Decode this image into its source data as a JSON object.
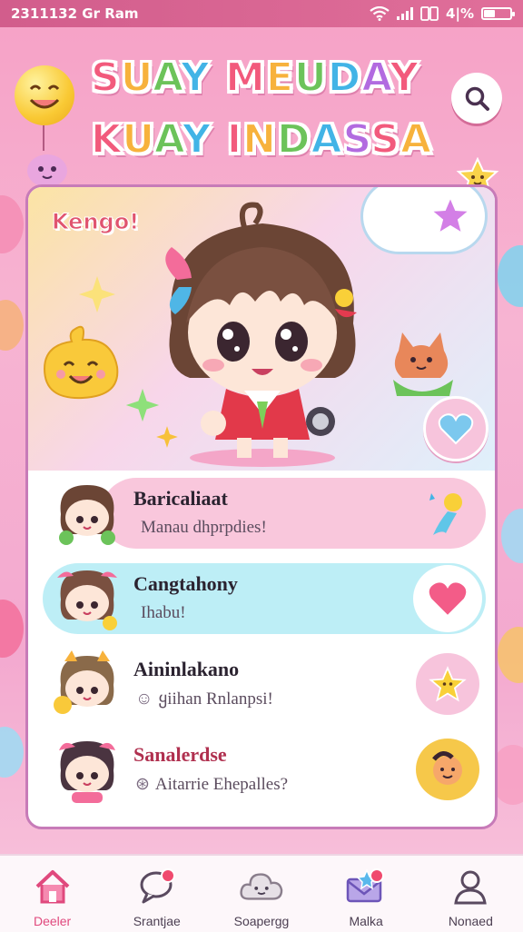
{
  "status_bar": {
    "left_text": "2311132 Gr Ram",
    "battery_text": "4|%"
  },
  "header": {
    "title_line1": "SUAY MEUDAY",
    "title_line2": "KUAY INDASSA"
  },
  "hero": {
    "bubble_text": "Kengo!"
  },
  "list": [
    {
      "title": "Baricaliaat",
      "subtitle": "Manau dhprpdies!",
      "sub_icon": ""
    },
    {
      "title": "Cangtahony",
      "subtitle": "Ihabu!",
      "sub_icon": ""
    },
    {
      "title": "Aininlakano",
      "subtitle": "ყiihan Rnlanpsi!",
      "sub_icon": "☺"
    },
    {
      "title": "Sanalerdse",
      "subtitle": "Aitarrie Ehepalles?",
      "sub_icon": "⊛"
    }
  ],
  "nav": [
    {
      "label": "Deeler",
      "icon": "home-icon"
    },
    {
      "label": "Srantjae",
      "icon": "chat-icon"
    },
    {
      "label": "Soapergg",
      "icon": "cloud-icon"
    },
    {
      "label": "Malka",
      "icon": "mail-star-icon"
    },
    {
      "label": "Nonaed",
      "icon": "profile-icon"
    }
  ],
  "colors": {
    "accent": "#e0497d",
    "row1_bg": "#f9c7dc",
    "row2_bg": "#bdeef6",
    "action_pink": "#f7c4dc",
    "action_yellow": "#f6c84a"
  }
}
